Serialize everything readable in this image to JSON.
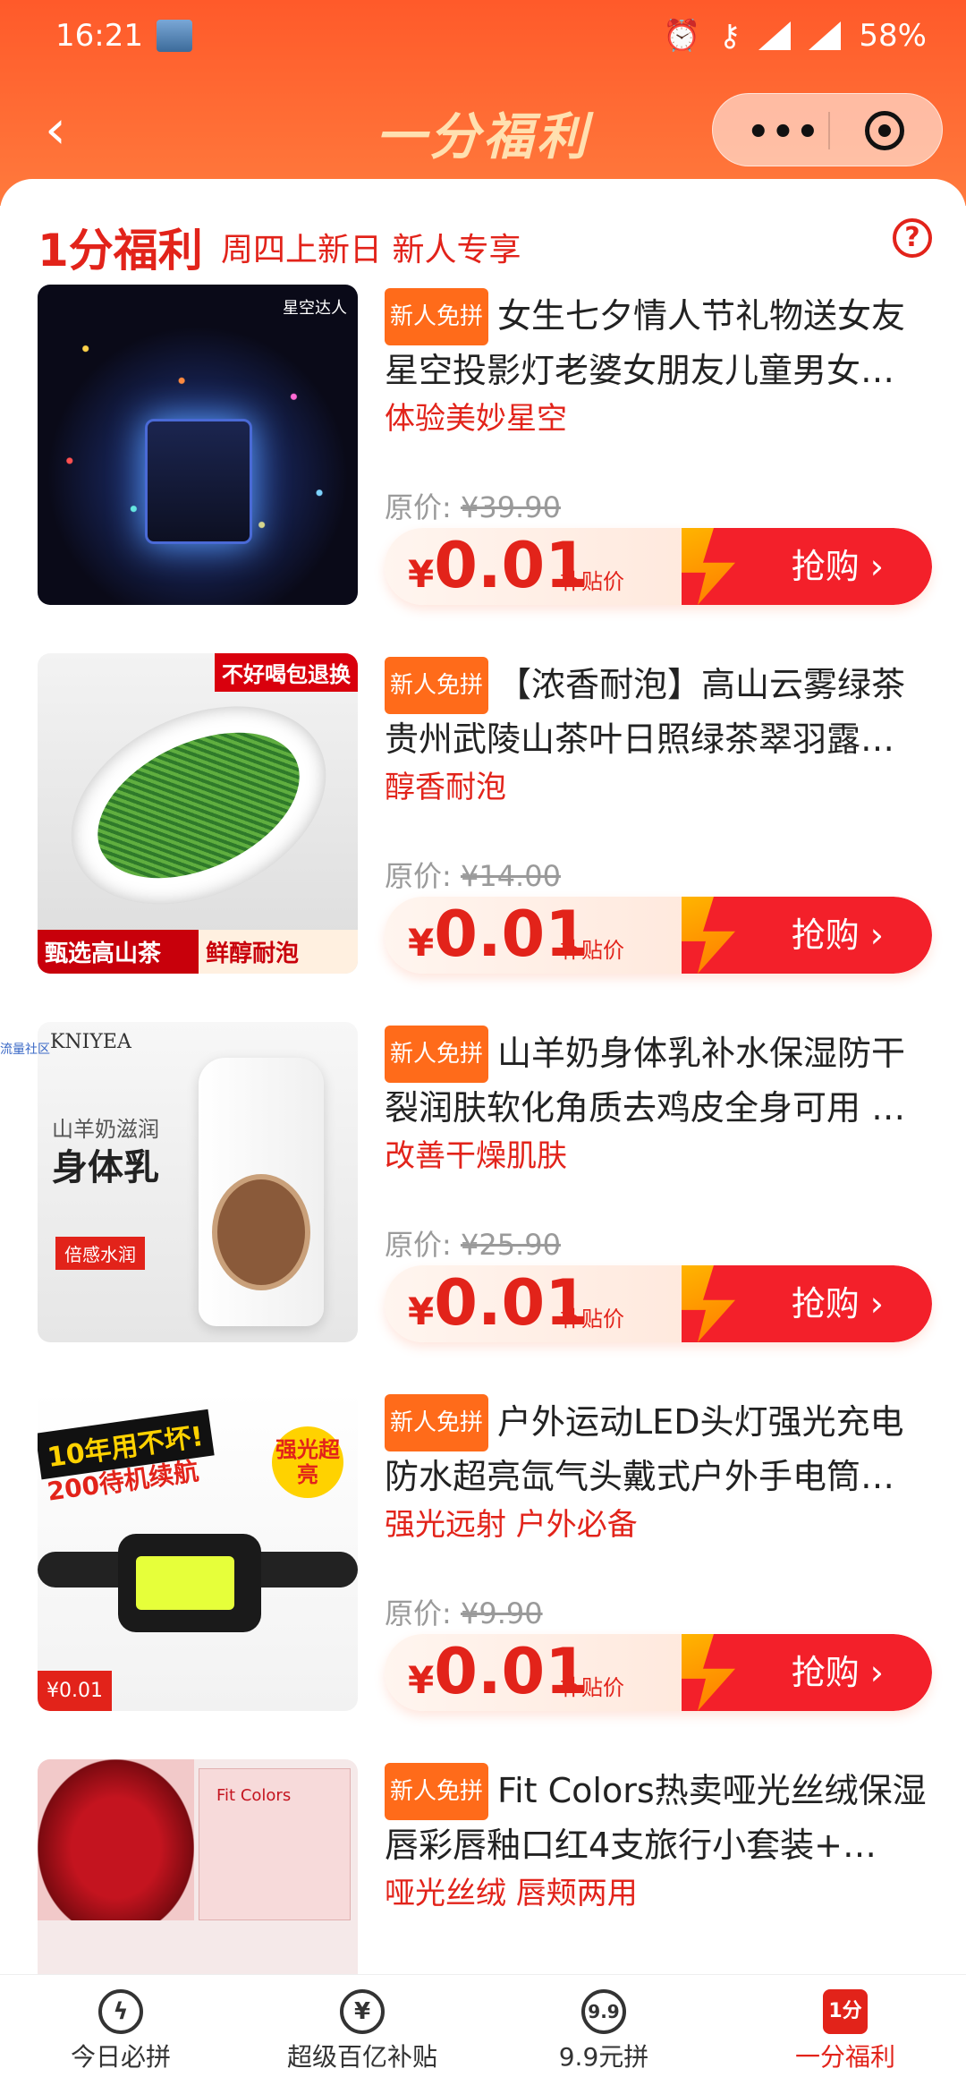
{
  "status": {
    "time": "16:21",
    "battery": "58%",
    "network": "4G"
  },
  "nav": {
    "title": "一分福利",
    "more": "•••"
  },
  "section": {
    "title": "1分福利",
    "subtitle": "周四上新日 新人专享",
    "help": "?"
  },
  "items": [
    {
      "tag": "新人免拼",
      "name": "女生七夕情人节礼物送女友星空投影灯老婆女朋友儿童男女…",
      "selling_point": "体验美妙星空",
      "original_label": "原价:",
      "original_price": "¥39.90",
      "price_symbol": "¥",
      "price": "0.01",
      "price_note": "补贴价",
      "cta": "抢购 ›",
      "image_text": "星空达人"
    },
    {
      "tag": "新人免拼",
      "name": "【浓香耐泡】高山云雾绿茶贵州武陵山茶叶日照绿茶翠羽露…",
      "selling_point": "醇香耐泡",
      "original_label": "原价:",
      "original_price": "¥14.00",
      "price_symbol": "¥",
      "price": "0.01",
      "price_note": "补贴价",
      "cta": "抢购 ›",
      "image_text": "不好喝包退换",
      "image_text_2": "甄选高山茶",
      "image_text_3": "鲜醇耐泡"
    },
    {
      "tag": "新人免拼",
      "name": "山羊奶身体乳补水保湿防干裂润肤软化角质去鸡皮全身可用 …",
      "selling_point": "改善干燥肌肤",
      "original_label": "原价:",
      "original_price": "¥25.90",
      "price_symbol": "¥",
      "price": "0.01",
      "price_note": "补贴价",
      "cta": "抢购 ›",
      "image_text": "KNIYEA",
      "image_text_2": "山羊奶滋润",
      "image_text_3": "身体乳",
      "image_text_4": "倍感水润"
    },
    {
      "tag": "新人免拼",
      "name": "户外运动LED头灯强光充电防水超亮氙气头戴式户外手电筒…",
      "selling_point": "强光远射 户外必备",
      "original_label": "原价:",
      "original_price": "¥9.90",
      "price_symbol": "¥",
      "price": "0.01",
      "price_note": "补贴价",
      "cta": "抢购 ›",
      "image_text": "10年用不坏!",
      "image_text_2": "200待机续航",
      "image_text_3": "强光超亮",
      "image_text_4": "¥0.01"
    },
    {
      "tag": "新人免拼",
      "name": "Fit Colors热卖哑光丝绒保湿唇彩唇釉口红4支旅行小套装+…",
      "selling_point": "哑光丝绒 唇颊两用",
      "image_text": "Fit Colors"
    }
  ],
  "tabs": [
    {
      "label": "今日必拼",
      "icon": "lightning-icon",
      "glyph": "ϟ"
    },
    {
      "label": "超级百亿补贴",
      "icon": "money-bag-icon",
      "glyph": "¥"
    },
    {
      "label": "9.9元拼",
      "icon": "nine-nine-icon",
      "glyph": "9.9"
    },
    {
      "label": "一分福利",
      "icon": "one-cent-icon",
      "glyph": "1分",
      "active": true
    }
  ],
  "side_mark": "流量社区",
  "colors": {
    "brand": "#ff5a2a",
    "accent": "#e2231a",
    "tag": "#ff6b1a"
  }
}
